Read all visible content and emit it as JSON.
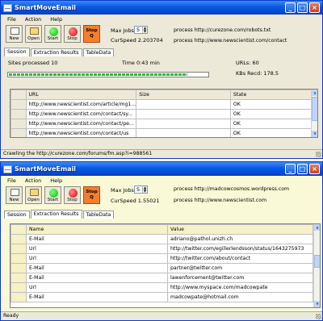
{
  "window1": {
    "title": "SmartMoveEmail",
    "menu": [
      "File",
      "Action",
      "Help"
    ],
    "toolbar": {
      "new": "New",
      "open": "Open",
      "start": "Start",
      "stop": "Stop",
      "stopq_line1": "Stop",
      "stopq_line2": "Q"
    },
    "max_jobs_label": "Max Jobs",
    "max_jobs_value": "5",
    "cur_speed_label": "CurSpeed",
    "cur_speed_value": "2.203704",
    "process1": "process http://curezone.com/robots.txt",
    "process2": "process http://www.newscientist.com/contact",
    "tabs": [
      "Session",
      "Extraction Results",
      "TableData"
    ],
    "sites_processed": "Sites processed 10",
    "time": "Time 0:43 min",
    "urls": "URLs: 60",
    "kbs": "KBs Recd: 178.5",
    "progress": 0.9,
    "table": {
      "headers": [
        "URL",
        "Size",
        "State"
      ],
      "rows": [
        [
          "http://www.newscientist.com/article/mg1...",
          "",
          "OK"
        ],
        [
          "http://www.newscientist.com/contact/sy...",
          "",
          "OK"
        ],
        [
          "http://www.newscientist.com/contact/pe...",
          "",
          "OK"
        ],
        [
          "http://www.newscientist.com/contact/us",
          "",
          "OK"
        ]
      ]
    },
    "status": "Crawling the http://curezone.com/forums/fm.asp?i=988561"
  },
  "window2": {
    "title": "SmartMoveEmail",
    "menu": [
      "File",
      "Action",
      "Help"
    ],
    "toolbar": {
      "new": "New",
      "open": "Open",
      "start": "Start",
      "stop": "Stop",
      "stopq_line1": "Stop",
      "stopq_line2": "Q"
    },
    "max_jobs_label": "Max Jobs",
    "max_jobs_value": "5",
    "cur_speed_label": "CurSpeed",
    "cur_speed_value": "1.55021",
    "process1": "process http://madcowcosmos.wordpress.com",
    "process2": "process http://www.newscientist.com",
    "tabs": [
      "Session",
      "Extraction Results",
      "TableData"
    ],
    "table": {
      "headers": [
        "Name",
        "Value"
      ],
      "rows": [
        [
          "E-Mail",
          "adriano@pathol.unizh.ch"
        ],
        [
          "Url",
          "http://twitter.com/egillerlendsson/status/1643275973"
        ],
        [
          "Url",
          "http://twitter.com/about/contact"
        ],
        [
          "E-Mail",
          "partner@twitter.com"
        ],
        [
          "E-Mail",
          "lawenforcement@twitter.com"
        ],
        [
          "Url",
          "http://www.myspace.com/madcowpate"
        ],
        [
          "E-Mail",
          "madcowpate@hotmail.com"
        ]
      ]
    },
    "status": "Ready"
  }
}
